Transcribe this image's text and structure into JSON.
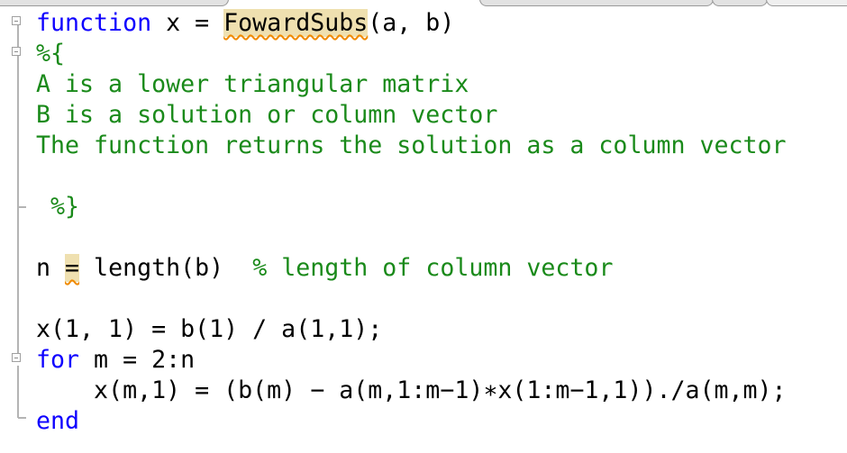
{
  "editor": {
    "function_name": "FowardSubs",
    "lines": {
      "l1": {
        "kw": "function",
        "pre": " x = ",
        "fname": "FowardSubs",
        "post": "(a, b)"
      },
      "l2": {
        "text": "%{"
      },
      "l3": {
        "text": "A is a lower triangular matrix"
      },
      "l4": {
        "text": "B is a solution or column vector"
      },
      "l5": {
        "text": "The function returns the solution as a column vector"
      },
      "l6": {
        "text": ""
      },
      "l7": {
        "text": " %}"
      },
      "l8": {
        "text": ""
      },
      "l9": {
        "pre": "n ",
        "eq": "=",
        "code": " length(b)  ",
        "comment": "% length of column vector"
      },
      "l10": {
        "text": ""
      },
      "l11": {
        "text": "x(1, 1) = b(1) / a(1,1);"
      },
      "l12": {
        "kw": "for",
        "code": " m = 2:n"
      },
      "l13": {
        "text": "    x(m,1) = (b(m) − a(m,1:m−1)∗x(1:m−1,1))./a(m,m);"
      },
      "l14": {
        "kw": "end"
      }
    }
  }
}
